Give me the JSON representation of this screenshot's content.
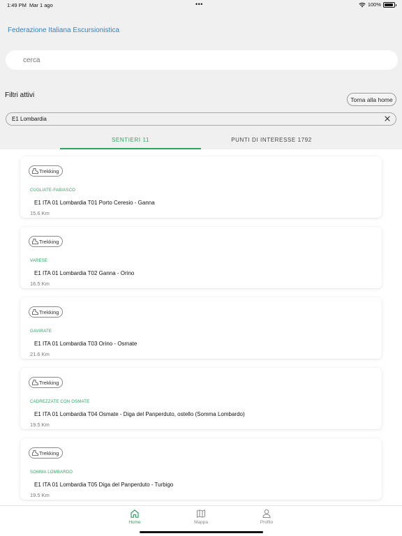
{
  "status_bar": {
    "time": "1:49 PM",
    "date": "Mar 1 ago",
    "dots": "•••",
    "battery": "100%"
  },
  "app_title": "Federazione Italiana Escursionistica",
  "search": {
    "placeholder": "cerca",
    "value": ""
  },
  "filters": {
    "title": "Filtri attivi",
    "home_button": "Torna alla home",
    "active_chip": "E1 Lombardia"
  },
  "tabs": [
    {
      "label": "SENTIERI 11",
      "selected": true
    },
    {
      "label": "PUNTI DI INTERESSE 1792",
      "selected": false
    }
  ],
  "trails": [
    {
      "tag": "Trekking",
      "location": "CUGLIATE-FABIASCO",
      "title": "E1 ITA 01 Lombardia T01 Porto Ceresio - Ganna",
      "distance": "15.6 Km"
    },
    {
      "tag": "Trekking",
      "location": "VARESE",
      "title": "E1 ITA 01 Lombardia T02 Ganna - Orino",
      "distance": "16.5 Km"
    },
    {
      "tag": "Trekking",
      "location": "GAVIRATE",
      "title": "E1 ITA 01 Lombardia T03 Orino - Osmate",
      "distance": "21.6 Km"
    },
    {
      "tag": "Trekking",
      "location": "CADREZZATE CON OSMATE",
      "title": "E1 ITA 01 Lombardia T04 Osmate - Diga del Panperduto, ostello (Somma Lombardo)",
      "distance": "19.5 Km"
    },
    {
      "tag": "Trekking",
      "location": "SOMMA LOMBARDO",
      "title": "E1 ITA 01 Lombardia T05 Diga del Panperduto - Turbigo",
      "distance": "19.5 Km"
    }
  ],
  "bottom_nav": [
    {
      "label": "Home",
      "icon": "home-icon",
      "active": true
    },
    {
      "label": "Mappa",
      "icon": "map-icon",
      "active": false
    },
    {
      "label": "Profilo",
      "icon": "profile-icon",
      "active": false
    }
  ],
  "colors": {
    "accent": "#2ca562",
    "title_blue": "#2a86c8",
    "header_bg": "#f0f0f0"
  }
}
